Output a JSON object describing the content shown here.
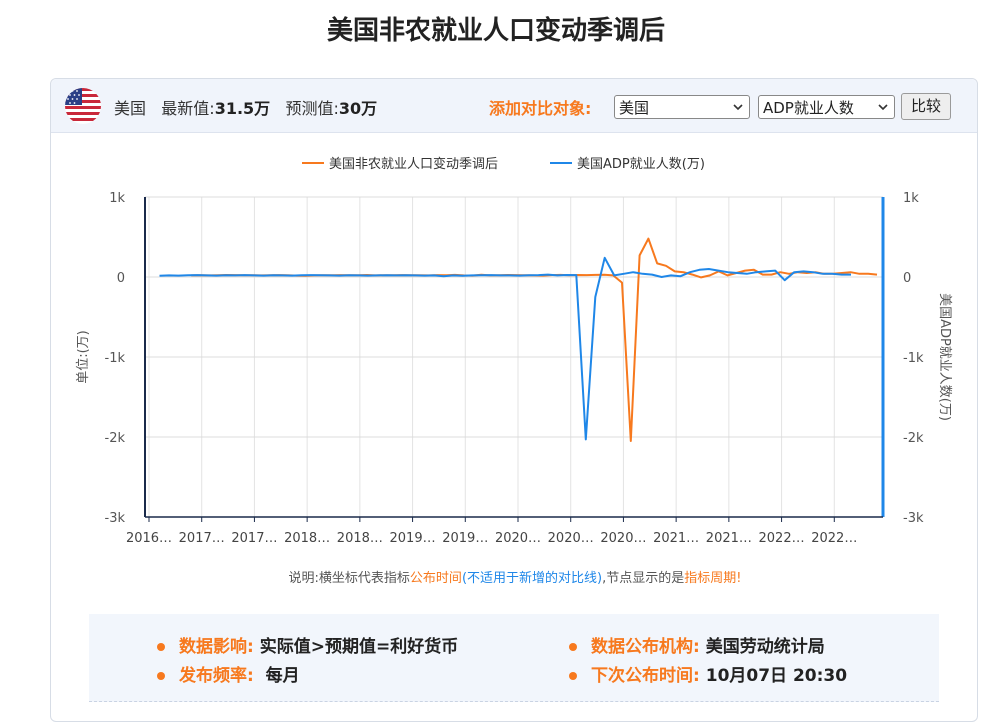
{
  "page": {
    "title": "美国非农就业人口变动季调后"
  },
  "header": {
    "country": "美国",
    "latest_label": "最新值:",
    "latest_value": "31.5万",
    "forecast_label": "预测值:",
    "forecast_value": "30万",
    "compare_label": "添加对比对象:",
    "select_country": "美国",
    "select_indicator": "ADP就业人数",
    "compare_button": "比较"
  },
  "note": {
    "prefix": "说明:横坐标代表指标",
    "release_time": "公布时间",
    "paren_open": "(",
    "not_applicable": "不适用于新增的对比线",
    "paren_close": ")",
    "middle": ",节点显示的是",
    "period": "指标周期!"
  },
  "info": {
    "impact_label": "数据影响:",
    "impact_value": "实际值>预期值=利好货币",
    "agency_label": "数据公布机构:",
    "agency_value": "美国劳动统计局",
    "freq_label": "发布频率:",
    "freq_value": "每月",
    "next_label": "下次公布时间:",
    "next_value": "10月07日 20:30"
  },
  "colors": {
    "series_nfp": "#f7791e",
    "series_adp": "#1f87e8",
    "left_axis": "#1a2a4a",
    "right_axis": "#1f87e8"
  },
  "chart_data": {
    "type": "line",
    "legend_position": "top-center",
    "grid": true,
    "ylabel_left": "单位:(万)",
    "ylabel_right": "美国ADP就业人数(万)",
    "ylim": [
      -3000,
      1000
    ],
    "yticks": [
      1000,
      0,
      -1000,
      -2000,
      -3000
    ],
    "ytick_labels": [
      "1k",
      "0",
      "-1k",
      "-2k",
      "-3k"
    ],
    "xtick_labels": [
      "2016…",
      "2017…",
      "2017…",
      "2018…",
      "2018…",
      "2019…",
      "2019…",
      "2020…",
      "2020…",
      "2020…",
      "2021…",
      "2021…",
      "2022…",
      "2022…"
    ],
    "series": [
      {
        "name": "美国非农就业人口变动季调后",
        "axis": "left",
        "values": [
          20,
          22,
          20,
          23,
          25,
          24,
          21,
          23,
          20,
          22,
          24,
          22,
          18,
          15,
          20,
          22,
          23,
          24,
          21,
          22,
          25,
          20,
          22,
          23,
          24,
          22,
          21,
          20,
          24,
          22,
          26,
          20,
          18,
          28,
          20,
          22,
          25,
          24,
          22,
          20,
          18,
          24,
          26,
          22,
          25,
          24,
          26,
          28,
          20,
          -70,
          -2050,
          270,
          480,
          170,
          140,
          70,
          60,
          30,
          -5,
          20,
          70,
          20,
          50,
          80,
          90,
          30,
          30,
          60,
          40,
          60,
          50,
          60,
          40,
          40,
          50,
          60,
          40,
          40,
          30
        ],
        "x_start": 0.8
      },
      {
        "name": "美国ADP就业人数(万)",
        "axis": "right",
        "values": [
          15,
          20,
          18,
          22,
          24,
          20,
          18,
          22,
          20,
          24,
          20,
          18,
          22,
          20,
          18,
          22,
          24,
          22,
          20,
          18,
          22,
          20,
          18,
          20,
          22,
          20,
          22,
          20,
          18,
          20,
          10,
          20,
          15,
          20,
          22,
          24,
          20,
          20,
          18,
          22,
          24,
          30,
          20,
          25,
          24,
          -2030,
          -250,
          240,
          20,
          40,
          60,
          40,
          30,
          0,
          20,
          10,
          60,
          90,
          100,
          80,
          60,
          50,
          40,
          60,
          70,
          80,
          -40,
          60,
          70,
          60,
          40,
          40,
          30,
          30
        ],
        "x_start": 0.2
      }
    ]
  }
}
